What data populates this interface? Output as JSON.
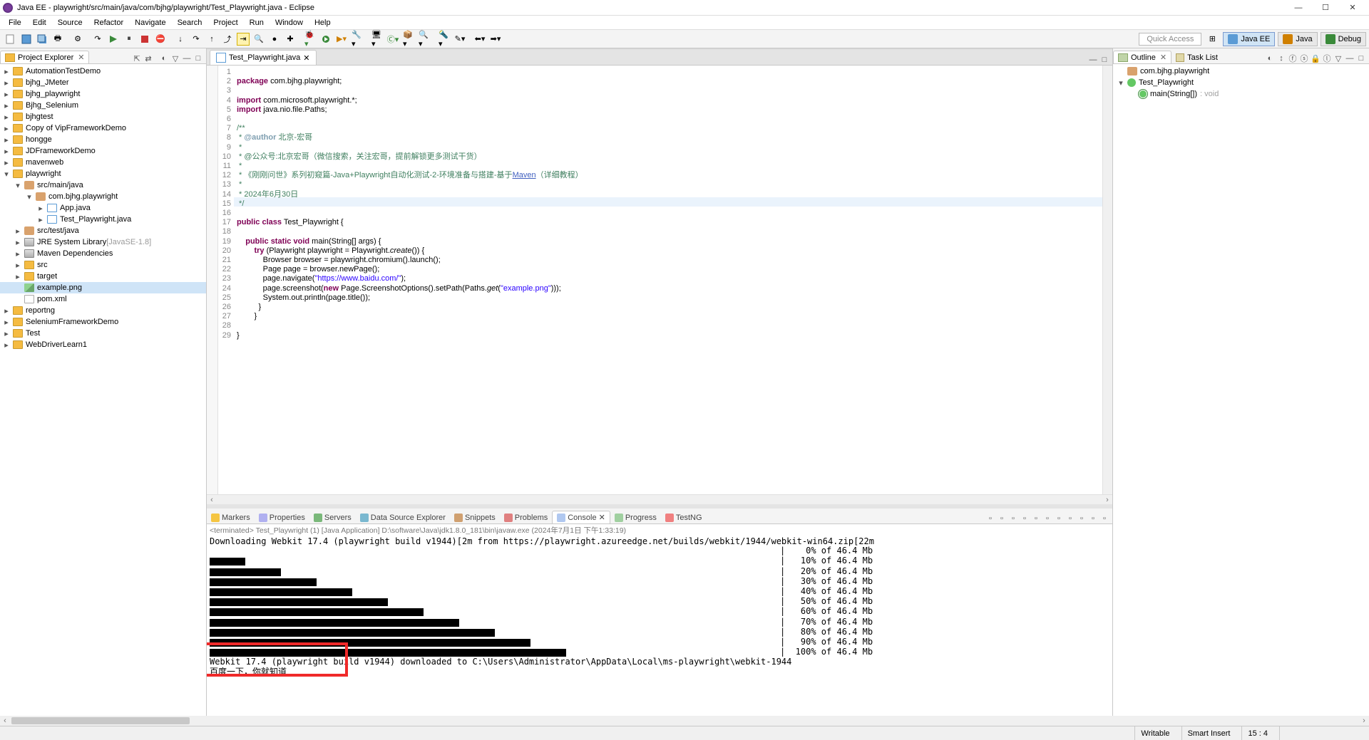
{
  "window": {
    "title": "Java EE - playwright/src/main/java/com/bjhg/playwright/Test_Playwright.java - Eclipse"
  },
  "menus": [
    "File",
    "Edit",
    "Source",
    "Refactor",
    "Navigate",
    "Search",
    "Project",
    "Run",
    "Window",
    "Help"
  ],
  "quick_access": "Quick Access",
  "perspectives": {
    "javaee": "Java EE",
    "java": "Java",
    "debug": "Debug"
  },
  "project_explorer": {
    "title": "Project Explorer",
    "items": [
      {
        "d": 0,
        "t": ">",
        "k": "folder",
        "l": "AutomationTestDemo"
      },
      {
        "d": 0,
        "t": ">",
        "k": "folder",
        "l": "bjhg_JMeter"
      },
      {
        "d": 0,
        "t": ">",
        "k": "folder",
        "l": "bjhg_playwright"
      },
      {
        "d": 0,
        "t": ">",
        "k": "folder",
        "l": "Bjhg_Selenium"
      },
      {
        "d": 0,
        "t": ">",
        "k": "folder",
        "l": "bjhgtest"
      },
      {
        "d": 0,
        "t": ">",
        "k": "folder",
        "l": "Copy of VipFrameworkDemo"
      },
      {
        "d": 0,
        "t": ">",
        "k": "folder",
        "l": "hongge"
      },
      {
        "d": 0,
        "t": ">",
        "k": "folder",
        "l": "JDFrameworkDemo"
      },
      {
        "d": 0,
        "t": ">",
        "k": "folder",
        "l": "mavenweb"
      },
      {
        "d": 0,
        "t": "v",
        "k": "folder",
        "l": "playwright"
      },
      {
        "d": 1,
        "t": "v",
        "k": "pkg",
        "l": "src/main/java"
      },
      {
        "d": 2,
        "t": "v",
        "k": "pkg",
        "l": "com.bjhg.playwright"
      },
      {
        "d": 3,
        "t": ">",
        "k": "java",
        "l": "App.java"
      },
      {
        "d": 3,
        "t": ">",
        "k": "java",
        "l": "Test_Playwright.java"
      },
      {
        "d": 1,
        "t": ">",
        "k": "pkg",
        "l": "src/test/java"
      },
      {
        "d": 1,
        "t": ">",
        "k": "jar",
        "l": "JRE System Library",
        "extra": "[JavaSE-1.8]"
      },
      {
        "d": 1,
        "t": ">",
        "k": "jar",
        "l": "Maven Dependencies"
      },
      {
        "d": 1,
        "t": ">",
        "k": "folder",
        "l": "src"
      },
      {
        "d": 1,
        "t": ">",
        "k": "folder",
        "l": "target"
      },
      {
        "d": 1,
        "t": "",
        "k": "img",
        "l": "example.png",
        "sel": true
      },
      {
        "d": 1,
        "t": "",
        "k": "xml",
        "l": "pom.xml"
      },
      {
        "d": 0,
        "t": ">",
        "k": "folder",
        "l": "reportng"
      },
      {
        "d": 0,
        "t": ">",
        "k": "folder",
        "l": "SeleniumFrameworkDemo"
      },
      {
        "d": 0,
        "t": ">",
        "k": "folder",
        "l": "Test"
      },
      {
        "d": 0,
        "t": ">",
        "k": "folder",
        "l": "WebDriverLearn1"
      }
    ]
  },
  "editor": {
    "tab": "Test_Playwright.java",
    "cursor_line": 15,
    "lines": [
      {
        "n": 1,
        "h": ""
      },
      {
        "n": 2,
        "h": "<span class='kw'>package</span> com.bjhg.playwright;"
      },
      {
        "n": 3,
        "h": ""
      },
      {
        "n": 4,
        "h": "<span class='kw'>import</span> com.microsoft.playwright.*;"
      },
      {
        "n": 5,
        "h": "<span class='kw'>import</span> java.nio.file.Paths;"
      },
      {
        "n": 6,
        "h": ""
      },
      {
        "n": 7,
        "h": "<span class='cmt'>/**</span>"
      },
      {
        "n": 8,
        "h": "<span class='cmt'> * <span class='cmt-tag'>@author</span> 北京-宏哥</span>"
      },
      {
        "n": 9,
        "h": "<span class='cmt'> *</span>"
      },
      {
        "n": 10,
        "h": "<span class='cmt'> * @公众号:北京宏哥（微信搜索，关注宏哥，提前解锁更多测试干货）</span>"
      },
      {
        "n": 11,
        "h": "<span class='cmt'> *</span>"
      },
      {
        "n": 12,
        "h": "<span class='cmt'> * 《刚刚问世》系列初窥篇-Java+Playwright自动化测试-2-环境准备与搭建-基于<span class='cmt-link'>Maven</span>（详细教程）</span>"
      },
      {
        "n": 13,
        "h": "<span class='cmt'> *</span>"
      },
      {
        "n": 14,
        "h": "<span class='cmt'> * 2024年6月30日</span>"
      },
      {
        "n": 15,
        "h": "<span class='cmt'> */</span>"
      },
      {
        "n": 16,
        "h": ""
      },
      {
        "n": 17,
        "h": "<span class='kw'>public</span> <span class='kw'>class</span> Test_Playwright {"
      },
      {
        "n": 18,
        "h": ""
      },
      {
        "n": 19,
        "h": "    <span class='kw'>public</span> <span class='kw'>static</span> <span class='kw'>void</span> main(String[] args) {"
      },
      {
        "n": 20,
        "h": "        <span class='kw'>try</span> (Playwright playwright = Playwright.<i>create</i>()) {"
      },
      {
        "n": 21,
        "h": "            Browser browser = playwright.chromium().launch();"
      },
      {
        "n": 22,
        "h": "            Page page = browser.newPage();"
      },
      {
        "n": 23,
        "h": "            page.navigate(<span class='str'>\"https://www.baidu.com/\"</span>);"
      },
      {
        "n": 24,
        "h": "            page.screenshot(<span class='kw'>new</span> Page.ScreenshotOptions().setPath(Paths.<i>get</i>(<span class='str'>\"example.png\"</span>)));"
      },
      {
        "n": 25,
        "h": "            System.out.println(page.title());"
      },
      {
        "n": 26,
        "h": "          }"
      },
      {
        "n": 27,
        "h": "        }"
      },
      {
        "n": 28,
        "h": ""
      },
      {
        "n": 29,
        "h": "}"
      }
    ]
  },
  "outline": {
    "tabs": [
      "Outline",
      "Task List"
    ],
    "nodes": [
      {
        "d": 0,
        "k": "pkg",
        "l": "com.bjhg.playwright"
      },
      {
        "d": 0,
        "k": "class",
        "l": "Test_Playwright",
        "t": "v"
      },
      {
        "d": 1,
        "k": "method",
        "l": "main(String[])",
        "ret": ": void"
      }
    ]
  },
  "bottom": {
    "tabs": [
      "Markers",
      "Properties",
      "Servers",
      "Data Source Explorer",
      "Snippets",
      "Problems",
      "Console",
      "Progress",
      "TestNG"
    ],
    "active": "Console",
    "header": "<terminated> Test_Playwright (1) [Java Application] D:\\software\\Java\\jdk1.8.0_181\\bin\\javaw.exe (2024年7月1日 下午1:33:19)",
    "download_line": "Downloading Webkit 17.4 (playwright build v1944)\u001b[2m from https://playwright.azureedge.net/builds/webkit/1944/webkit-win64.zip\u001b[22m",
    "progress": [
      {
        "pct": 0
      },
      {
        "pct": 10
      },
      {
        "pct": 20
      },
      {
        "pct": 30
      },
      {
        "pct": 40
      },
      {
        "pct": 50
      },
      {
        "pct": 60
      },
      {
        "pct": 70
      },
      {
        "pct": 80
      },
      {
        "pct": 90
      },
      {
        "pct": 100
      }
    ],
    "size": "46.4 Mb",
    "footer1": "Webkit 17.4 (playwright build v1944) downloaded to C:\\Users\\Administrator\\AppData\\Local\\ms-playwright\\webkit-1944",
    "footer2": "百度一下，你就知道"
  },
  "status": {
    "writable": "Writable",
    "insert": "Smart Insert",
    "pos": "15 : 4"
  }
}
